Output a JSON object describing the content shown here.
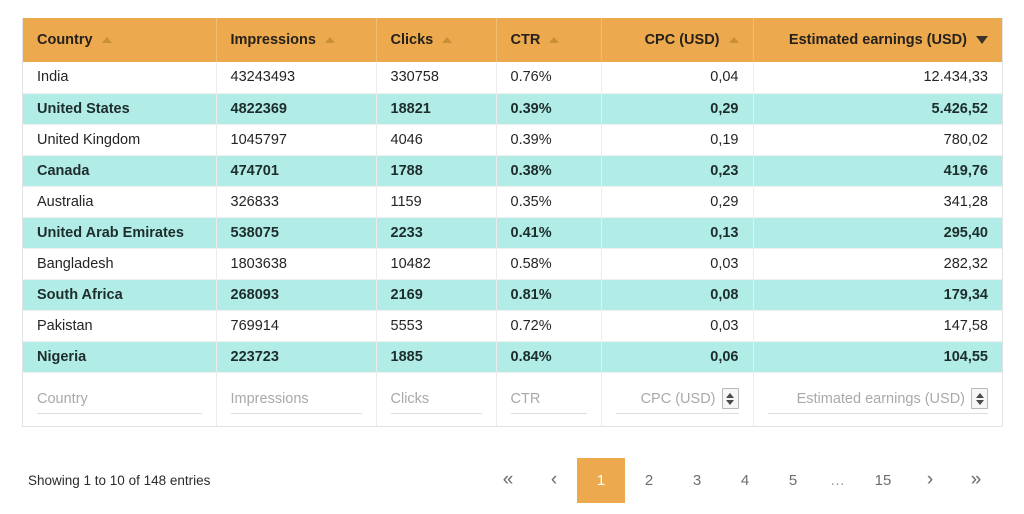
{
  "table": {
    "columns": [
      {
        "key": "country",
        "label": "Country",
        "align": "left",
        "sort": "asc"
      },
      {
        "key": "impressions",
        "label": "Impressions",
        "align": "left",
        "sort": "asc"
      },
      {
        "key": "clicks",
        "label": "Clicks",
        "align": "left",
        "sort": "asc"
      },
      {
        "key": "ctr",
        "label": "CTR",
        "align": "left",
        "sort": "asc"
      },
      {
        "key": "cpc",
        "label": "CPC (USD)",
        "align": "right",
        "sort": "asc"
      },
      {
        "key": "earnings",
        "label": "Estimated earnings (USD)",
        "align": "right",
        "sort": "desc-active"
      }
    ],
    "rows": [
      {
        "country": "India",
        "impressions": "43243493",
        "clicks": "330758",
        "ctr": "0.76%",
        "cpc": "0,04",
        "earnings": "12.434,33"
      },
      {
        "country": "United States",
        "impressions": "4822369",
        "clicks": "18821",
        "ctr": "0.39%",
        "cpc": "0,29",
        "earnings": "5.426,52"
      },
      {
        "country": "United Kingdom",
        "impressions": "1045797",
        "clicks": "4046",
        "ctr": "0.39%",
        "cpc": "0,19",
        "earnings": "780,02"
      },
      {
        "country": "Canada",
        "impressions": "474701",
        "clicks": "1788",
        "ctr": "0.38%",
        "cpc": "0,23",
        "earnings": "419,76"
      },
      {
        "country": "Australia",
        "impressions": "326833",
        "clicks": "1159",
        "ctr": "0.35%",
        "cpc": "0,29",
        "earnings": "341,28"
      },
      {
        "country": "United Arab Emirates",
        "impressions": "538075",
        "clicks": "2233",
        "ctr": "0.41%",
        "cpc": "0,13",
        "earnings": "295,40"
      },
      {
        "country": "Bangladesh",
        "impressions": "1803638",
        "clicks": "10482",
        "ctr": "0.58%",
        "cpc": "0,03",
        "earnings": "282,32"
      },
      {
        "country": "South Africa",
        "impressions": "268093",
        "clicks": "2169",
        "ctr": "0.81%",
        "cpc": "0,08",
        "earnings": "179,34"
      },
      {
        "country": "Pakistan",
        "impressions": "769914",
        "clicks": "5553",
        "ctr": "0.72%",
        "cpc": "0,03",
        "earnings": "147,58"
      },
      {
        "country": "Nigeria",
        "impressions": "223723",
        "clicks": "1885",
        "ctr": "0.84%",
        "cpc": "0,06",
        "earnings": "104,55"
      }
    ],
    "filters": [
      {
        "key": "country",
        "placeholder": "Country",
        "value": "",
        "align": "left",
        "spinner": false
      },
      {
        "key": "impressions",
        "placeholder": "Impressions",
        "value": "",
        "align": "left",
        "spinner": false
      },
      {
        "key": "clicks",
        "placeholder": "Clicks",
        "value": "",
        "align": "left",
        "spinner": false
      },
      {
        "key": "ctr",
        "placeholder": "CTR",
        "value": "",
        "align": "left",
        "spinner": false
      },
      {
        "key": "cpc",
        "placeholder": "CPC (USD)",
        "value": "",
        "align": "right",
        "spinner": true
      },
      {
        "key": "earnings",
        "placeholder": "Estimated earnings (USD)",
        "value": "",
        "align": "right",
        "spinner": true
      }
    ]
  },
  "footer": {
    "showing": "Showing 1 to 10 of 148 entries",
    "pagination": {
      "first_label": "«",
      "prev_label": "‹",
      "next_label": "›",
      "last_label": "»",
      "ellipsis": "…",
      "active_page": "1",
      "pages": [
        "1",
        "2",
        "3",
        "4",
        "5"
      ],
      "last_page": "15"
    }
  },
  "colors": {
    "header_orange": "#eda94d",
    "row_teal": "#b1ece7",
    "row_white": "#ffffff",
    "active_page_bg": "#eda94d"
  }
}
